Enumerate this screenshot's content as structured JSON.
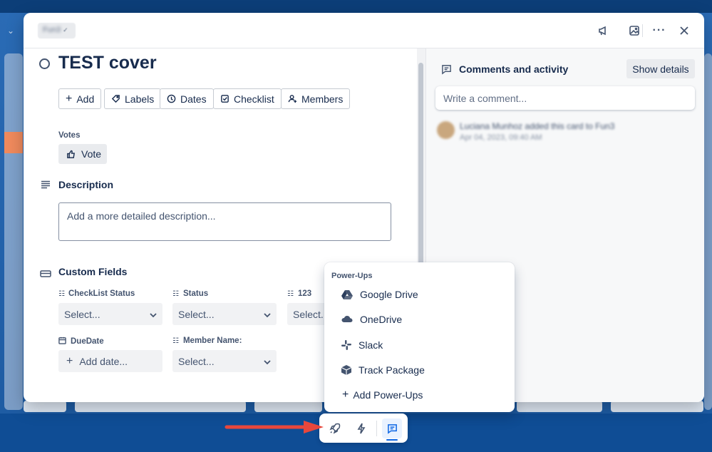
{
  "card": {
    "list_name": "Fun3",
    "title": "TEST cover"
  },
  "actions": {
    "add": "Add",
    "labels": "Labels",
    "dates": "Dates",
    "checklist": "Checklist",
    "members": "Members"
  },
  "votes": {
    "label": "Votes",
    "button": "Vote"
  },
  "description": {
    "title": "Description",
    "placeholder": "Add a more detailed description..."
  },
  "custom_fields": {
    "title": "Custom Fields",
    "fields": [
      {
        "label": "CheckList Status",
        "value": "Select..."
      },
      {
        "label": "Status",
        "value": "Select..."
      },
      {
        "label": "123",
        "value": "Select..."
      },
      {
        "label": "DueDate",
        "value": "Add date..."
      },
      {
        "label": "Member Name:",
        "value": "Select..."
      }
    ]
  },
  "activity": {
    "title": "Comments and activity",
    "show_details": "Show details",
    "comment_placeholder": "Write a comment...",
    "entries": [
      {
        "text": "Luciana Munhoz added this card to Fun3",
        "time": "Apr 04, 2023, 09:40 AM"
      }
    ]
  },
  "powerups": {
    "heading": "Power-Ups",
    "items": [
      "Google Drive",
      "OneDrive",
      "Slack",
      "Track Package"
    ],
    "add": "Add Power-Ups"
  },
  "toolbar": {
    "icons": [
      "rocket-icon",
      "lightning-icon",
      "comment-icon"
    ]
  },
  "colors": {
    "accent": "#0c66e4",
    "annotation_arrow": "#e8473c"
  }
}
